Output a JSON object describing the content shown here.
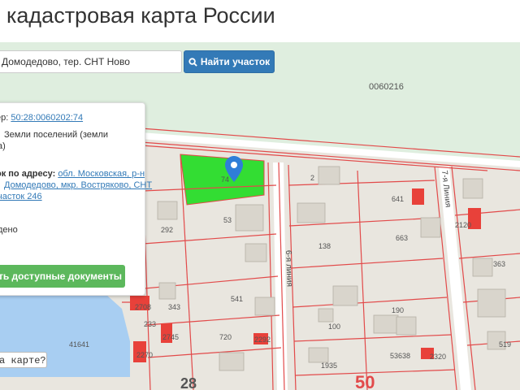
{
  "header": {
    "title": "кадастровая карта России"
  },
  "search": {
    "value": "Домодедово, тер. СНТ Ново",
    "button_label": "Найти участок"
  },
  "popup": {
    "cadastral_label": "ер:",
    "cadastral_number": "50:28:0060202:74",
    "category_line1": "Земли поселений (земли",
    "category_line2": "а)",
    "address_label": "ок по адресу:",
    "address_link_line1": "обл. Московская, р-н",
    "address_link_line2": "Домодедово, мкр. Востряково, СНТ",
    "address_link_line3": "часток 246",
    "line_dash": ".",
    "status_text": "дено",
    "docs_button_label": "ть доступные документы"
  },
  "map": {
    "ask_button_label": "а карте?",
    "labels": {
      "block": "0060216",
      "street_6": "6-я линия",
      "street_7": "7-я Линия",
      "big_number": "50"
    },
    "plot_numbers": [
      "74",
      "53",
      "292",
      "2",
      "641",
      "663",
      "138",
      "2120",
      "363",
      "541",
      "343",
      "2708",
      "233",
      "720",
      "2292",
      "2745",
      "190",
      "100",
      "1935",
      "53638",
      "2320",
      "519",
      "41641",
      "2270",
      "28"
    ],
    "colors": {
      "selected_parcel": "#33dd33",
      "boundary": "#e24a4a",
      "building": "#e8413a",
      "water": "#a8cef2",
      "park": "#dfeedf",
      "road": "#ffffff",
      "land": "#e9e6df"
    }
  }
}
